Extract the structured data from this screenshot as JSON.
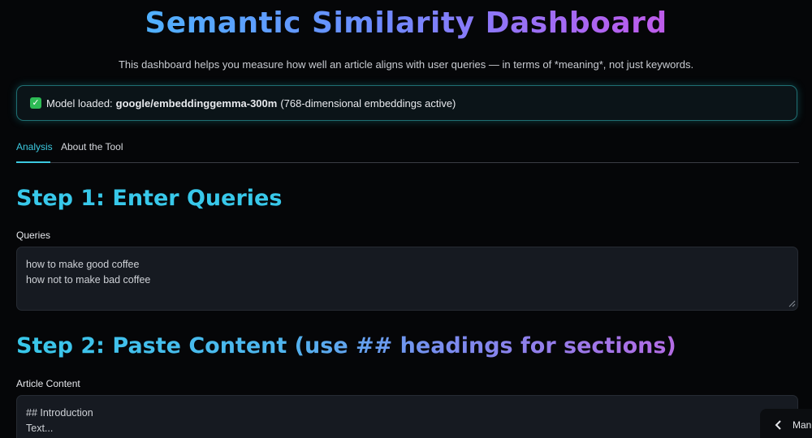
{
  "header": {
    "title": "Semantic Similarity Dashboard",
    "subtitle": "This dashboard helps you measure how well an article aligns with user queries — in terms of *meaning*, not just keywords."
  },
  "model_status": {
    "icon": "check-icon",
    "prefix": "Model loaded:",
    "model_name": "google/embeddinggemma-300m",
    "suffix": "(768-dimensional embeddings active)"
  },
  "tabs": [
    {
      "label": "Analysis",
      "active": true
    },
    {
      "label": "About the Tool",
      "active": false
    }
  ],
  "step1": {
    "heading": "Step 1: Enter Queries",
    "label": "Queries",
    "value": "how to make good coffee\nhow not to make bad coffee"
  },
  "step2": {
    "heading": "Step 2: Paste Content (use ## headings for sections)",
    "label": "Article Content",
    "value": "## Introduction\nText..."
  },
  "manage_button": {
    "label": "Man",
    "icon": "chevron-left-icon"
  },
  "colors": {
    "accent": "#3cc9e0",
    "background": "#050608",
    "success": "#2dbb55",
    "gradient_end": "#e14bd8"
  }
}
